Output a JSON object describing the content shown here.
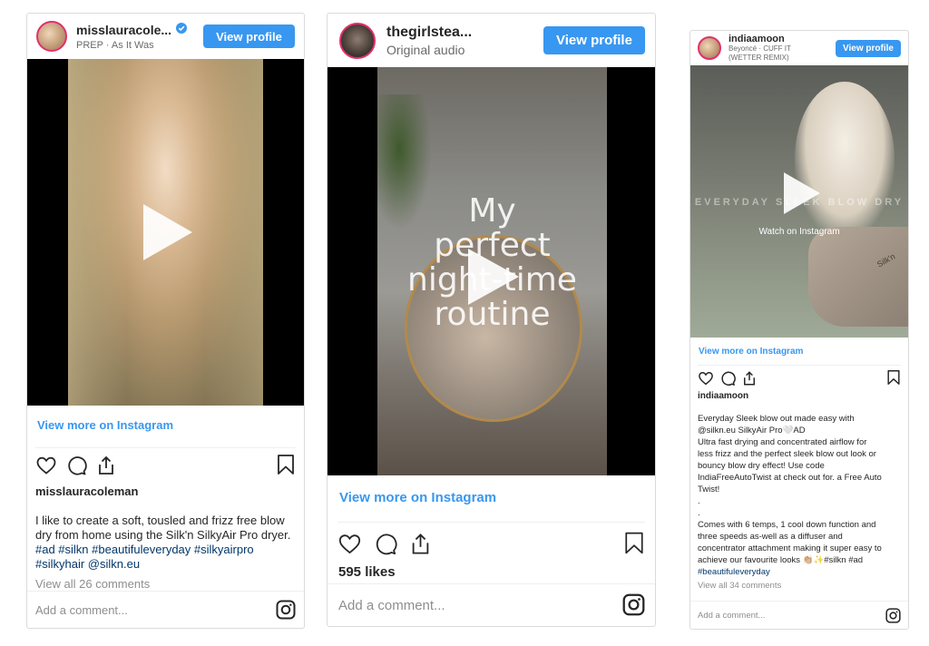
{
  "cards": [
    {
      "username": "misslauracole...",
      "subtitle": "PREP · As It Was",
      "view_profile": "View profile",
      "view_more": "View more on Instagram",
      "caption_user": "misslauracoleman",
      "caption_lines": [
        "I like to create a soft, tousled and frizz free blow",
        "dry from home using the Silk'n SilkyAir Pro dryer."
      ],
      "hashtag_lines": [
        "#ad #silkn #beautifuleveryday #silkyairpro",
        "#silkyhair @silkn.eu"
      ],
      "view_all": "View all 26 comments",
      "add_comment": "Add a comment..."
    },
    {
      "username": "thegirlstea...",
      "subtitle": "Original audio",
      "view_profile": "View profile",
      "overlay_lines": [
        "My",
        "perfect",
        "night-time",
        "routine"
      ],
      "view_more": "View more on Instagram",
      "likes": "595 likes",
      "add_comment": "Add a comment..."
    },
    {
      "username": "indiaamoon",
      "subtitle_lines": [
        "Beyoncé · CUFF IT",
        "(WETTER REMIX)"
      ],
      "view_profile": "View profile",
      "overlay_text": "EVERYDAY SLEEK BLOW DRY",
      "watch_on": "Watch on Instagram",
      "brand": "Silk'n",
      "view_more": "View more on Instagram",
      "caption_user": "indiaamoon",
      "caption_lines": [
        "Everyday Sleek blow out made easy with",
        "@silkn.eu SilkyAir Pro🤍AD",
        "Ultra fast drying and concentrated airflow for",
        "less frizz and the perfect sleek blow out look or",
        "bouncy blow dry effect! Use code",
        "IndiaFreeAutoTwist at check out for. a Free Auto",
        "Twist!",
        ".",
        ".",
        "Comes with 6 temps, 1 cool down function and",
        "three speeds as-well as a diffuser and",
        "concentrator attachment making it super easy to",
        "achieve our favourite looks 👏🏼✨#silkn #ad",
        "#beautifuleveryday"
      ],
      "view_all": "View all 34 comments",
      "add_comment": "Add a comment..."
    }
  ],
  "colors": {
    "link_blue": "#3897f0",
    "hashtag": "#00376b",
    "verified": "#3897f0"
  },
  "icons": [
    "heart-icon",
    "comment-icon",
    "share-icon",
    "bookmark-icon",
    "instagram-icon",
    "play-icon",
    "verified-icon"
  ]
}
